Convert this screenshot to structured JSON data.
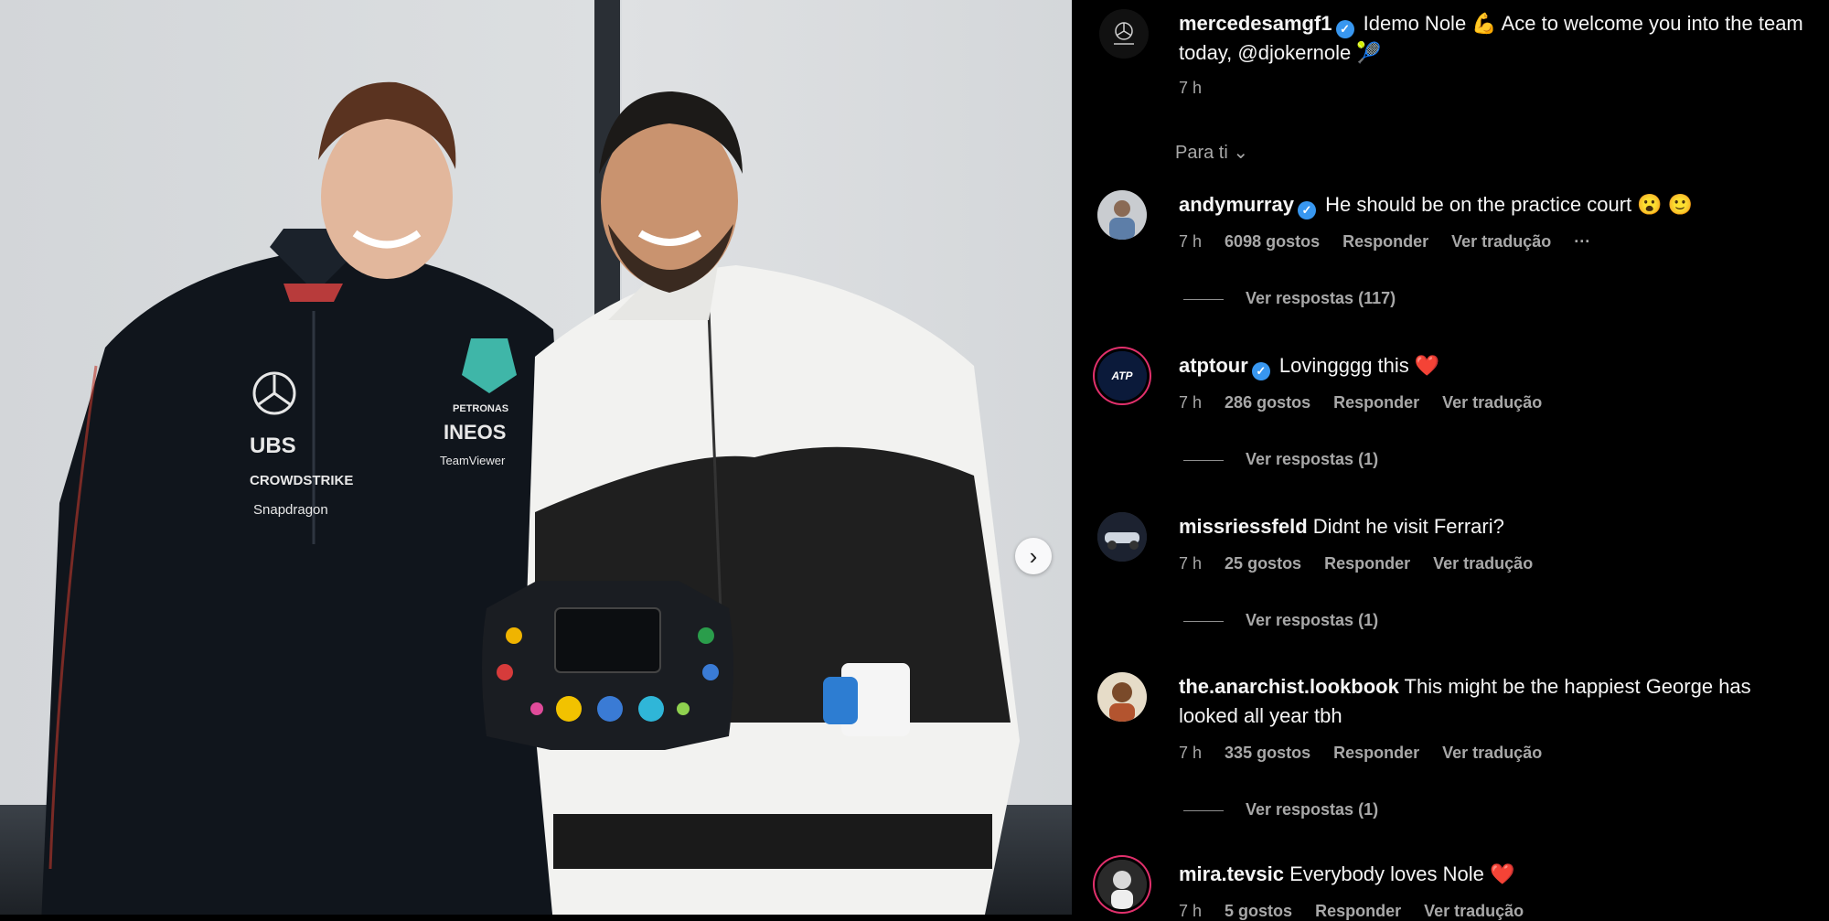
{
  "post": {
    "username": "mercedesamgf1",
    "caption": "Idemo Nole 💪 Ace to welcome you into the team today, @djokernole 🎾",
    "time": "7 h"
  },
  "filter_label": "Para ti ⌄",
  "comments": [
    {
      "username": "andymurray",
      "verified": true,
      "text": "He should be on the practice court 😮 🙂",
      "time": "7 h",
      "likes": "6098 gostos",
      "reply": "Responder",
      "translate": "Ver tradução",
      "more": "···",
      "replies": "Ver respostas (117)"
    },
    {
      "username": "atptour",
      "verified": true,
      "text": "Lovingggg this ❤️",
      "time": "7 h",
      "likes": "286 gostos",
      "reply": "Responder",
      "translate": "Ver tradução",
      "replies": "Ver respostas (1)"
    },
    {
      "username": "missriessfeld",
      "verified": false,
      "text": "Didnt he visit Ferrari?",
      "time": "7 h",
      "likes": "25 gostos",
      "reply": "Responder",
      "translate": "Ver tradução",
      "replies": "Ver respostas (1)"
    },
    {
      "username": "the.anarchist.lookbook",
      "verified": false,
      "text": "This might be the happiest George has looked all year tbh",
      "time": "7 h",
      "likes": "335 gostos",
      "reply": "Responder",
      "translate": "Ver tradução",
      "replies": "Ver respostas (1)"
    },
    {
      "username": "mira.tevsic",
      "verified": false,
      "text": "Everybody loves Nole ❤️",
      "time": "7 h",
      "likes": "5 gostos",
      "reply": "Responder",
      "translate": "Ver tradução"
    }
  ],
  "photo": {
    "left_jacket_text": [
      "UBS",
      "CROWDSTRIKE",
      "Snapdragon"
    ],
    "right_jacket_text": [
      "PETRONAS",
      "INEOS",
      "TeamViewer"
    ],
    "next_icon": "chevron-right-icon"
  },
  "colors": {
    "verified": "#3897f0",
    "link": "#e0f1ff",
    "muted": "#a8a8a8"
  }
}
